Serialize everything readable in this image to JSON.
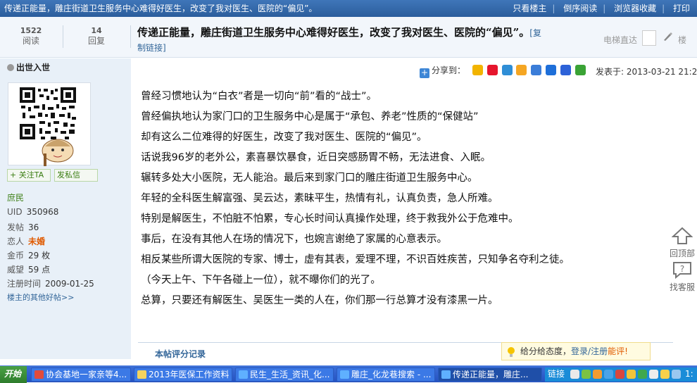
{
  "topbar": {
    "title": "传递正能量，雕庄街道卫生服务中心难得好医生，改变了我对医生、医院的“偏见”。",
    "links": [
      "只看楼主",
      "倒序阅读",
      "浏览器收藏",
      "打印"
    ]
  },
  "header": {
    "views_num": "1522",
    "views_label": "阅读",
    "replies_num": "14",
    "replies_label": "回复",
    "thread_title": "传递正能量，雕庄街道卫生服务中心难得好医生，改变了我对医生、医院的“偏见”。",
    "copy_link_label_1": "[复",
    "copy_link_label_2": "制链接]",
    "elevator_label": "电梯直达",
    "floor_label": "楼"
  },
  "user": {
    "name": "出世入世",
    "follow_label": "+ 关注TA",
    "message_label": "发私信",
    "rank": "庶民",
    "uid_label": "UID",
    "uid": "350968",
    "posts_label": "发帖",
    "posts": "36",
    "love_label": "恋人",
    "love": "未婚",
    "gold_label": "金币",
    "gold": "29 枚",
    "prestige_label": "威望",
    "prestige": "59 点",
    "regtime_label": "注册时间",
    "regtime": "2009-01-25",
    "other_posts_label": "楼主的其他好帖>>"
  },
  "post": {
    "share_label": "分享到：",
    "post_time": "发表于: 2013-03-21 21:25",
    "lines": [
      "曾经习惯地认为“白衣”者是一切向“前”看的“战士”。",
      "曾经偏执地认为家门口的卫生服务中心是属于“承包、养老”性质的“保健站”",
      "却有这么二位难得的好医生，改变了我对医生、医院的“偏见”。",
      "话说我96岁的老外公，素喜暴饮暴食，近日突感肠胃不畅，无法进食、入眠。",
      "辗转多处大小医院，无人能治。最后来到家门口的雕庄街道卫生服务中心。",
      "年轻的全科医生解富强、吴云达，素昧平生，热情有礼，认真负责，急人所难。",
      "特别是解医生，不怕脏不怕累，专心长时间认真操作处理，终于救我外公于危难中。",
      "事后，在没有其他人在场的情况下，也婉言谢绝了家属的心意表示。",
      "相反某些所谓大医院的专家、博士，虚有其表，爱理不理，不识百姓疾苦，只知争名夺利之徒。",
      "（今天上午、下午各碰上一位），就不曝你们的光了。",
      "总算，只要还有解医生、吴医生一类的人在，你们那一行总算才没有漆黑一片。"
    ],
    "rating_label": "本帖评分记录"
  },
  "side_buttons": {
    "top_label": "回顶部",
    "service_label": "找客服"
  },
  "tip": {
    "text": "给分给态度，",
    "login": "登录",
    "slash": "/",
    "register": "注册",
    "action": "能评!"
  },
  "taskbar": {
    "start": "开始",
    "tasks": [
      "协会基地一家亲等4...",
      "2013年医保工作资料",
      "民生_生活_资讯_化...",
      "雕庄_化龙巷搜索 - ...",
      "传递正能量，雕庄..."
    ],
    "tray_label": "链接",
    "time": "1:"
  },
  "colors": {
    "topbar": "#2f66a8",
    "sidebar": "#e8f0f8",
    "link": "#336699",
    "green": "#3a7d12",
    "taskbar": "#2f5fc8"
  }
}
